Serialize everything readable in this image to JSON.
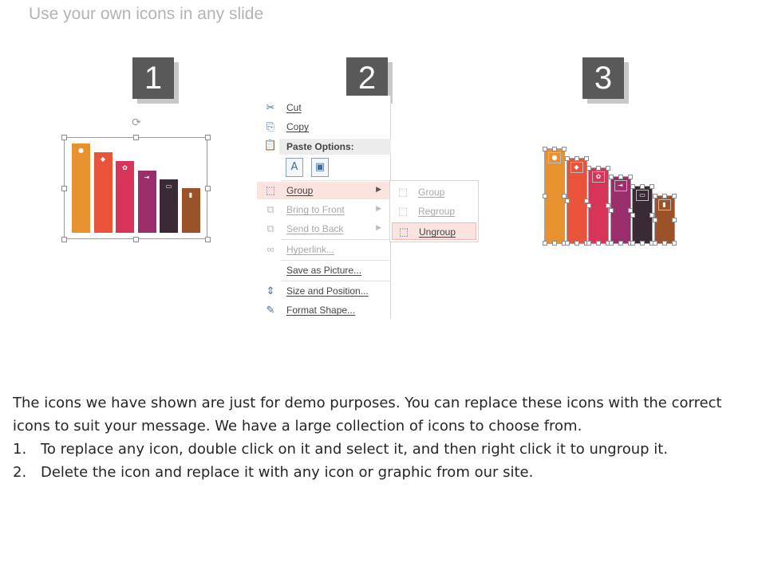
{
  "slide": {
    "title": "Use your own icons in any slide"
  },
  "steps": [
    {
      "number": "1"
    },
    {
      "number": "2"
    },
    {
      "number": "3"
    }
  ],
  "colors": {
    "bars": [
      "#e8912f",
      "#e9533a",
      "#d83459",
      "#9a2d6b",
      "#3a2a36",
      "#9c5228"
    ],
    "menu_highlight": "#fbe3e0",
    "badge": "#595959"
  },
  "bar_levels": [
    1.0,
    0.9,
    0.8,
    0.7,
    0.6,
    0.5
  ],
  "bar_icons": [
    "money-bag-icon",
    "piggy-bank-icon",
    "handshake-icon",
    "login-icon",
    "cash-icon",
    "bar-chart-icon"
  ],
  "context_menu": {
    "items": [
      {
        "label": "Cut",
        "icon": "scissors-icon",
        "glyph": "✂"
      },
      {
        "label": "Copy",
        "icon": "copy-icon",
        "glyph": "⎘"
      },
      {
        "label": "Group",
        "icon": "group-icon",
        "glyph": "⬚"
      },
      {
        "label": "Bring to Front",
        "icon": "bring-to-front-icon",
        "glyph": "⧉"
      },
      {
        "label": "Send to Back",
        "icon": "send-to-back-icon",
        "glyph": "⧉"
      },
      {
        "label": "Hyperlink...",
        "icon": "hyperlink-icon",
        "glyph": "∞"
      },
      {
        "label": "Save as Picture...",
        "icon": "",
        "glyph": ""
      },
      {
        "label": "Size and Position...",
        "icon": "size-position-icon",
        "glyph": "⇕"
      },
      {
        "label": "Format Shape...",
        "icon": "format-shape-icon",
        "glyph": "✎"
      }
    ],
    "paste_header": "Paste Options:",
    "paste_icons": [
      "paste-keep-formatting-icon",
      "paste-picture-icon"
    ]
  },
  "group_submenu": {
    "items": [
      {
        "label": "Group",
        "icon": "group-icon"
      },
      {
        "label": "Regroup",
        "icon": "regroup-icon"
      },
      {
        "label": "Ungroup",
        "icon": "ungroup-icon"
      }
    ]
  },
  "body": {
    "intro": "The icons we have shown are just for demo purposes. You can replace these icons with the correct icons to suit your message. We have a large collection of icons to choose from.",
    "list": [
      {
        "num": "1.",
        "text": "To replace any icon, double click on it and select it, and then right click it to ungroup it."
      },
      {
        "num": "2.",
        "text": "Delete the icon and replace it with any icon or graphic from our site."
      }
    ]
  }
}
